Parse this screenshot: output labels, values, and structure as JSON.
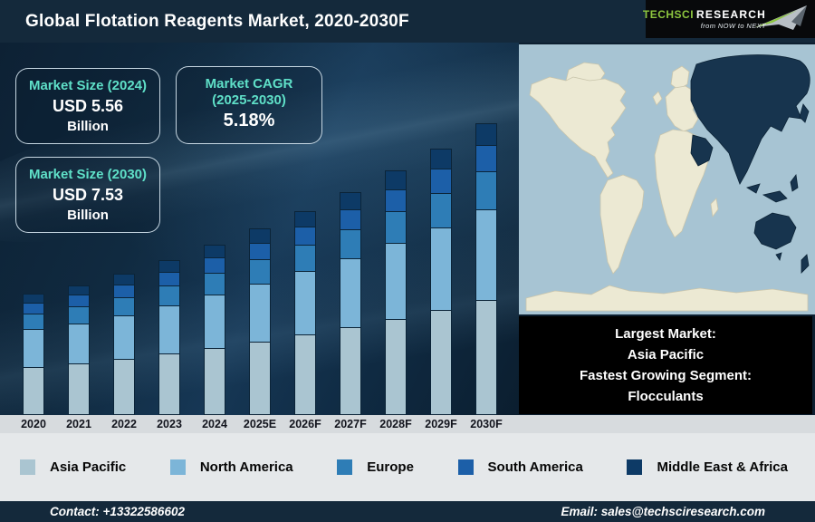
{
  "header": {
    "title": "Global Flotation Reagents Market, 2020-2030F",
    "logo": {
      "brand": "TechSci",
      "brand2": "Research",
      "tagline": "from NOW to NEXT"
    }
  },
  "stat_boxes": [
    {
      "label": "Market Size (2024)",
      "value": "USD 5.56",
      "unit": "Billion"
    },
    {
      "label": "Market CAGR\n(2025-2030)",
      "value": "5.18%",
      "unit": ""
    },
    {
      "label": "Market Size (2030)",
      "value": "USD 7.53",
      "unit": "Billion"
    }
  ],
  "chart_data": {
    "type": "bar",
    "stacked": true,
    "title": "Global Flotation Reagents Market, 2020-2030F",
    "value_unit": "USD Billion",
    "categories": [
      "2020",
      "2021",
      "2022",
      "2023",
      "2024",
      "2025E",
      "2026F",
      "2027F",
      "2028F",
      "2029F",
      "2030F"
    ],
    "series": [
      {
        "name": "Asia Pacific",
        "color": "#aac5d1",
        "values": [
          1.79,
          1.86,
          1.95,
          2.06,
          2.17,
          2.28,
          2.4,
          2.52,
          2.66,
          2.79,
          2.94
        ]
      },
      {
        "name": "North America",
        "color": "#7cb5d8",
        "values": [
          1.43,
          1.48,
          1.55,
          1.63,
          1.72,
          1.81,
          1.91,
          2.01,
          2.11,
          2.22,
          2.33
        ]
      },
      {
        "name": "Europe",
        "color": "#2e7db6",
        "values": [
          0.6,
          0.62,
          0.65,
          0.69,
          0.72,
          0.76,
          0.8,
          0.84,
          0.89,
          0.93,
          0.98
        ]
      },
      {
        "name": "South America",
        "color": "#1c5fa8",
        "values": [
          0.41,
          0.43,
          0.45,
          0.47,
          0.5,
          0.53,
          0.55,
          0.58,
          0.61,
          0.64,
          0.68
        ]
      },
      {
        "name": "Middle East & Africa",
        "color": "#0d3a66",
        "values": [
          0.37,
          0.38,
          0.4,
          0.42,
          0.45,
          0.47,
          0.49,
          0.52,
          0.54,
          0.57,
          0.6
        ]
      }
    ],
    "ylim": [
      0,
      8
    ],
    "grid": false,
    "axis_labels_visible": "x-only",
    "legend_position": "bottom"
  },
  "map": {
    "highlighted_region": "Asia Pacific",
    "ocean_color": "#a7c4d3",
    "land_color": "#ece9d3",
    "highlight_color": "#17344e"
  },
  "highlight_box": {
    "lines": [
      "Largest Market:",
      "Asia Pacific",
      "Fastest Growing Segment:",
      "Flocculants"
    ]
  },
  "footer": {
    "contact": "Contact: +13322586602",
    "email": "Email: sales@techsciresearch.com"
  },
  "colors": {
    "header_bg": "#14293b",
    "footer_bg": "#14293b",
    "accent_teal": "#5fe0c8",
    "panel_dark": "#0e2337",
    "logo_green": "#8dc63f",
    "axis_strip": "#d7dbde",
    "legend_bg": "#e5e8ea",
    "highlight_box_bg": "#000000"
  }
}
